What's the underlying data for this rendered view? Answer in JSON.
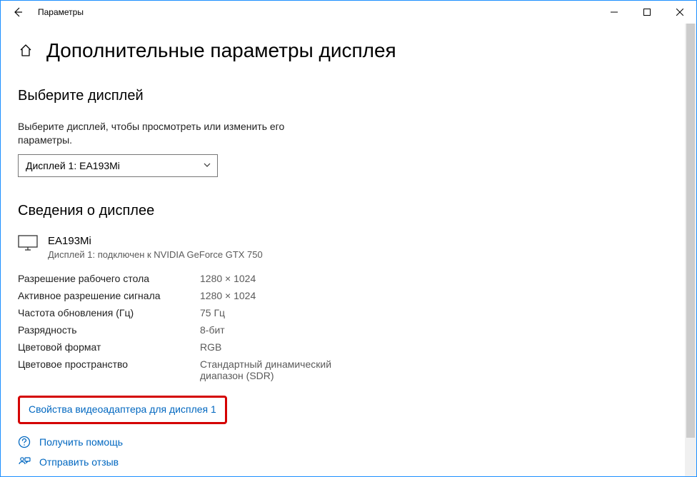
{
  "window": {
    "title": "Параметры"
  },
  "page": {
    "heading": "Дополнительные параметры дисплея",
    "select_display_head": "Выберите дисплей",
    "select_display_desc": "Выберите дисплей, чтобы просмотреть или изменить его параметры.",
    "dropdown_value": "Дисплей 1: EA193Mi",
    "info_head": "Сведения о дисплее",
    "monitor_name": "EA193Mi",
    "monitor_sub": "Дисплей 1: подключен к NVIDIA GeForce GTX 750",
    "rows": [
      {
        "label": "Разрешение рабочего стола",
        "value": "1280 × 1024"
      },
      {
        "label": "Активное разрешение сигнала",
        "value": "1280 × 1024"
      },
      {
        "label": "Частота обновления (Гц)",
        "value": "75 Гц"
      },
      {
        "label": "Разрядность",
        "value": "8-бит"
      },
      {
        "label": "Цветовой формат",
        "value": "RGB"
      },
      {
        "label": "Цветовое пространство",
        "value": "Стандартный динамический диапазон (SDR)"
      }
    ],
    "adapter_link": "Свойства видеоадаптера для дисплея 1",
    "help_link": "Получить помощь",
    "feedback_link": "Отправить отзыв"
  }
}
